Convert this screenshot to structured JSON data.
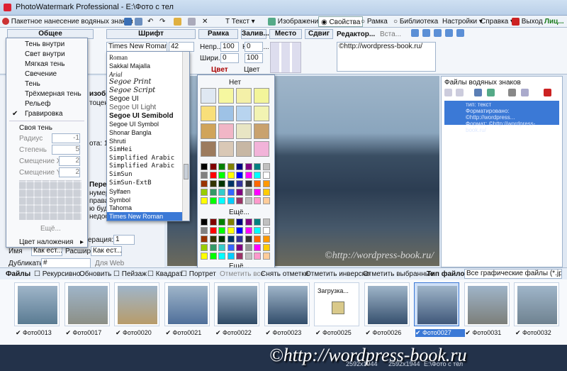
{
  "window": {
    "title": "PhotoWatermark Professional - E:\\Фото с тел"
  },
  "toolbar": {
    "batch": "Пакетное нанесение водяных знаков",
    "text": "Текст",
    "image": "Изображение",
    "properties": "Свойства",
    "frame": "Рамка",
    "library": "Библиотека",
    "settings": "Настройки",
    "help": "Справка",
    "exit": "Выход",
    "license": "Лиц..."
  },
  "ribbon": {
    "tabs": [
      "Общее",
      "Шрифт",
      "Рамка",
      "Залив...",
      "Место",
      "Сдвиг",
      "Редактор..."
    ],
    "font_name": "Times New Roman",
    "font_size": "42",
    "opacity_label": "Непр...",
    "opacity_value": "100",
    "width_label": "Шири...",
    "width_value": "0",
    "fill_opacity_label": "Непро...",
    "fill_opacity_value": "100",
    "fill_value": "0",
    "fill_value2": "100",
    "color_label": "Цвет",
    "color_label2": "Цвет",
    "editor_text": "©http://wordpress-book.ru/",
    "all_label": "Вста..."
  },
  "effects_menu": {
    "items": [
      "Тень внутри",
      "Свет внутри",
      "Мягкая тень",
      "Свечение",
      "Тень",
      "Трёхмерная тень",
      "Рельеф",
      "Гравировка"
    ],
    "checked": "Гравировка",
    "own_shadow": "Своя тень",
    "radius_label": "Радиус",
    "radius_value": "-1",
    "degree_label": "Степень",
    "degree_value": "5",
    "shift_x_label": "Смещение X",
    "shift_x_value": "2",
    "shift_y_label": "Смещение Y",
    "shift_y_value": "2",
    "more": "Ещё...",
    "overlay": "Цвет наложения"
  },
  "fonts": {
    "items": [
      "Roman",
      "Sakkal Majalla",
      "Arial",
      "Segoe Print",
      "Segoe Script",
      "Segoe UI",
      "Segoe UI Light",
      "Segoe UI Semibold",
      "Segoe UI Symbol",
      "Shonar Bangla",
      "Shruti",
      "SimHei",
      "Simplified Arabic",
      "Simplified Arabic",
      "SimSun",
      "SimSun-ExtB",
      "Sylfaen",
      "Symbol",
      "Tahoma",
      "Times New Roman"
    ],
    "selected": "Times New Roman"
  },
  "colors": {
    "none": "Нет",
    "more1": "Ещё...",
    "more2": "Ещё...",
    "palette": [
      "#000000",
      "#800000",
      "#008000",
      "#808000",
      "#000080",
      "#800080",
      "#008080",
      "#c0c0c0",
      "#808080",
      "#ff0000",
      "#00ff00",
      "#ffff00",
      "#0000ff",
      "#ff00ff",
      "#00ffff",
      "#ffffff",
      "#993300",
      "#333300",
      "#003300",
      "#003366",
      "#333399",
      "#333333",
      "#ff6600",
      "#ff9900",
      "#99cc00",
      "#339966",
      "#33cccc",
      "#3366ff",
      "#800080",
      "#969696",
      "#ff00ff",
      "#ffcc00",
      "#ffff00",
      "#00ff00",
      "#00ffff",
      "#00ccff",
      "#993366",
      "#c0c0c0",
      "#ff99cc",
      "#ffcc99",
      "#ffff99",
      "#ccffcc",
      "#ccffff",
      "#99ccff",
      "#cc99ff",
      "#ffffff"
    ]
  },
  "left_panel": {
    "image_label": "изобр",
    "tocenter": "тоцентр",
    "quality": "ота: 1",
    "rename": "Переи",
    "numbering": "нумера",
    "rights": "права т",
    "added": "ю будет",
    "unavailable": "недоступ",
    "numbering2": "Нумерация:",
    "start_value": "1",
    "name_label": "Имя",
    "name_value": "Как ест...",
    "ext_label": "Расширен",
    "ext_value": "Как ест...",
    "dup_label": "Дубликаты",
    "dup_value": "#",
    "web_label": "Для Web"
  },
  "right_panel": {
    "title": "Файлы водяных знаков",
    "selected_line1": "тип: текст",
    "selected_line2": "Форматировано: ©http://wordpress...",
    "selected_line3": "Формат: ©http://wordpress-book.ru/"
  },
  "files_bar": {
    "files": "Файлы",
    "recursive": "Рекурсивно",
    "refresh": "Обновить",
    "landscape": "Пейзаж",
    "square": "Квадрат",
    "portrait": "Портрет",
    "mark_all": "Отметить все",
    "unmark": "Снять отметки",
    "invert": "Отметить инверсно",
    "mark_selected": "Отметить выбранные",
    "filetype_label": "Тип файлов",
    "filetype_value": "Все графические файлы (*.jpg;*."
  },
  "files": [
    {
      "name": "Фото0013",
      "color": "#5a7b92"
    },
    {
      "name": "Фото0017",
      "color": "#8c8f86"
    },
    {
      "name": "Фото0020",
      "color": "#b89c6a"
    },
    {
      "name": "Фото0021",
      "color": "#4f6f9a"
    },
    {
      "name": "Фото0022",
      "color": "#2f4a66"
    },
    {
      "name": "Фото0023",
      "color": "#324d6b"
    },
    {
      "name": "Фото0025",
      "color": "#ffffff",
      "loading": "Загрузка..."
    },
    {
      "name": "Фото0026",
      "color": "#36506e"
    },
    {
      "name": "Фото0027",
      "color": "#40587a",
      "selected": true
    },
    {
      "name": "Фото0031",
      "color": "#7c7f7a"
    },
    {
      "name": "Фото0032",
      "color": "#6f8290"
    }
  ],
  "preview": {
    "watermark": "©http://wordpress-book.ru/"
  },
  "status": {
    "watermark": "©http://wordpress-book.ru",
    "resolution": "2592x1944",
    "resolution2": "2592x1944",
    "folder": "E:\\Фото с тел"
  }
}
